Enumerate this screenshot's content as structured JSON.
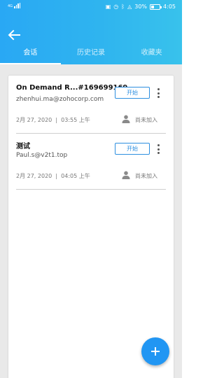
{
  "status_bar": {
    "network": "4G",
    "battery_percent": "30%",
    "time": "4:05"
  },
  "tabs": [
    {
      "label": "会话",
      "active": true
    },
    {
      "label": "历史记录",
      "active": false
    },
    {
      "label": "收藏夹",
      "active": false
    }
  ],
  "sessions": [
    {
      "title": "On Demand R...#169699169",
      "email": "zhenhui.ma@zohocorp.com",
      "start_label": "开始",
      "date": "2月 27, 2020",
      "separator": "|",
      "time": "03:55 上午",
      "status": "尚未加入"
    },
    {
      "title": "测试",
      "email": "Paul.s@v2t1.top",
      "start_label": "开始",
      "date": "2月 27, 2020",
      "separator": "|",
      "time": "04:05 上午",
      "status": "尚未加入"
    }
  ],
  "colors": {
    "header_start": "#29a8f4",
    "header_end": "#38c2ec",
    "accent": "#2d8fe0",
    "fab": "#2196f3"
  },
  "icons": [
    "back-arrow-icon",
    "more-vert-icon",
    "person-icon",
    "add-icon"
  ]
}
